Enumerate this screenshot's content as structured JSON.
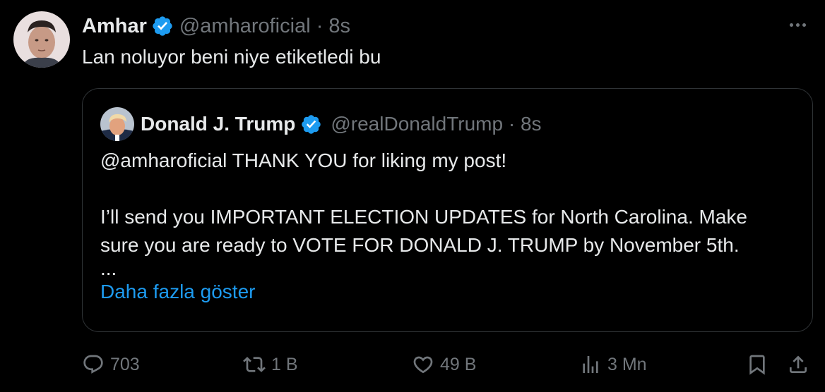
{
  "author": {
    "name": "Amhar",
    "handle": "@amharoficial",
    "time": "· 8s",
    "text": "Lan noluyor beni niye etiketledi bu",
    "verified_icon": "verified-badge-icon"
  },
  "quote": {
    "name": "Donald J. Trump",
    "handle": "@realDonaldTrump",
    "time": "· 8s",
    "line1": "@amharoficial THANK YOU for liking my post!",
    "line2": "I’ll send you IMPORTANT ELECTION UPDATES for North Carolina. Make",
    "line3": "sure you are ready to VOTE FOR DONALD J. TRUMP by November 5th.",
    "ellipsis": "...",
    "show_more": "Daha fazla göster"
  },
  "actions": {
    "replies": "703",
    "reposts": "1 B",
    "likes": "49 B",
    "views": "3 Mn"
  },
  "colors": {
    "background": "#000000",
    "text": "#e7e9ea",
    "muted": "#71767b",
    "link": "#1d9bf0",
    "border": "#2f3336",
    "verified": "#1d9bf0"
  }
}
